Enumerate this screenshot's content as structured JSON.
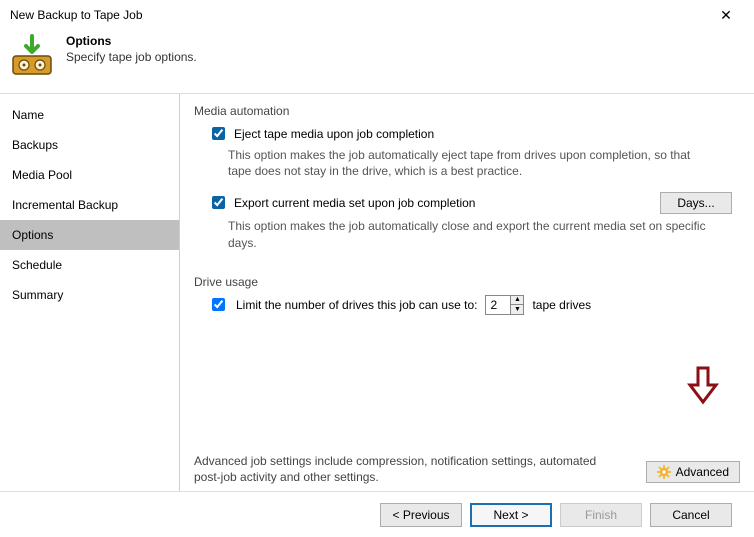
{
  "window": {
    "title": "New Backup to Tape Job"
  },
  "header": {
    "title": "Options",
    "subtitle": "Specify tape job options."
  },
  "sidebar": {
    "items": [
      {
        "label": "Name"
      },
      {
        "label": "Backups"
      },
      {
        "label": "Media Pool"
      },
      {
        "label": "Incremental Backup"
      },
      {
        "label": "Options"
      },
      {
        "label": "Schedule"
      },
      {
        "label": "Summary"
      }
    ],
    "selected_index": 4
  },
  "content": {
    "media_automation": {
      "title": "Media automation",
      "eject": {
        "label": "Eject tape media upon job completion",
        "description": "This option makes the job automatically eject tape from drives upon completion, so that tape does not stay in the drive, which is a best practice.",
        "checked": true
      },
      "export": {
        "label": "Export current media set upon job completion",
        "description": "This option makes the job automatically close and export the current media set on specific days.",
        "checked": true,
        "days_button": "Days..."
      }
    },
    "drive_usage": {
      "title": "Drive usage",
      "limit": {
        "label": "Limit the number of drives this job can use to:",
        "checked": true,
        "value": "2",
        "suffix": "tape drives"
      }
    },
    "advanced": {
      "note": "Advanced job settings include compression, notification settings, automated post-job activity and other settings.",
      "button": "Advanced"
    }
  },
  "footer": {
    "previous": "< Previous",
    "next": "Next >",
    "finish": "Finish",
    "cancel": "Cancel"
  }
}
